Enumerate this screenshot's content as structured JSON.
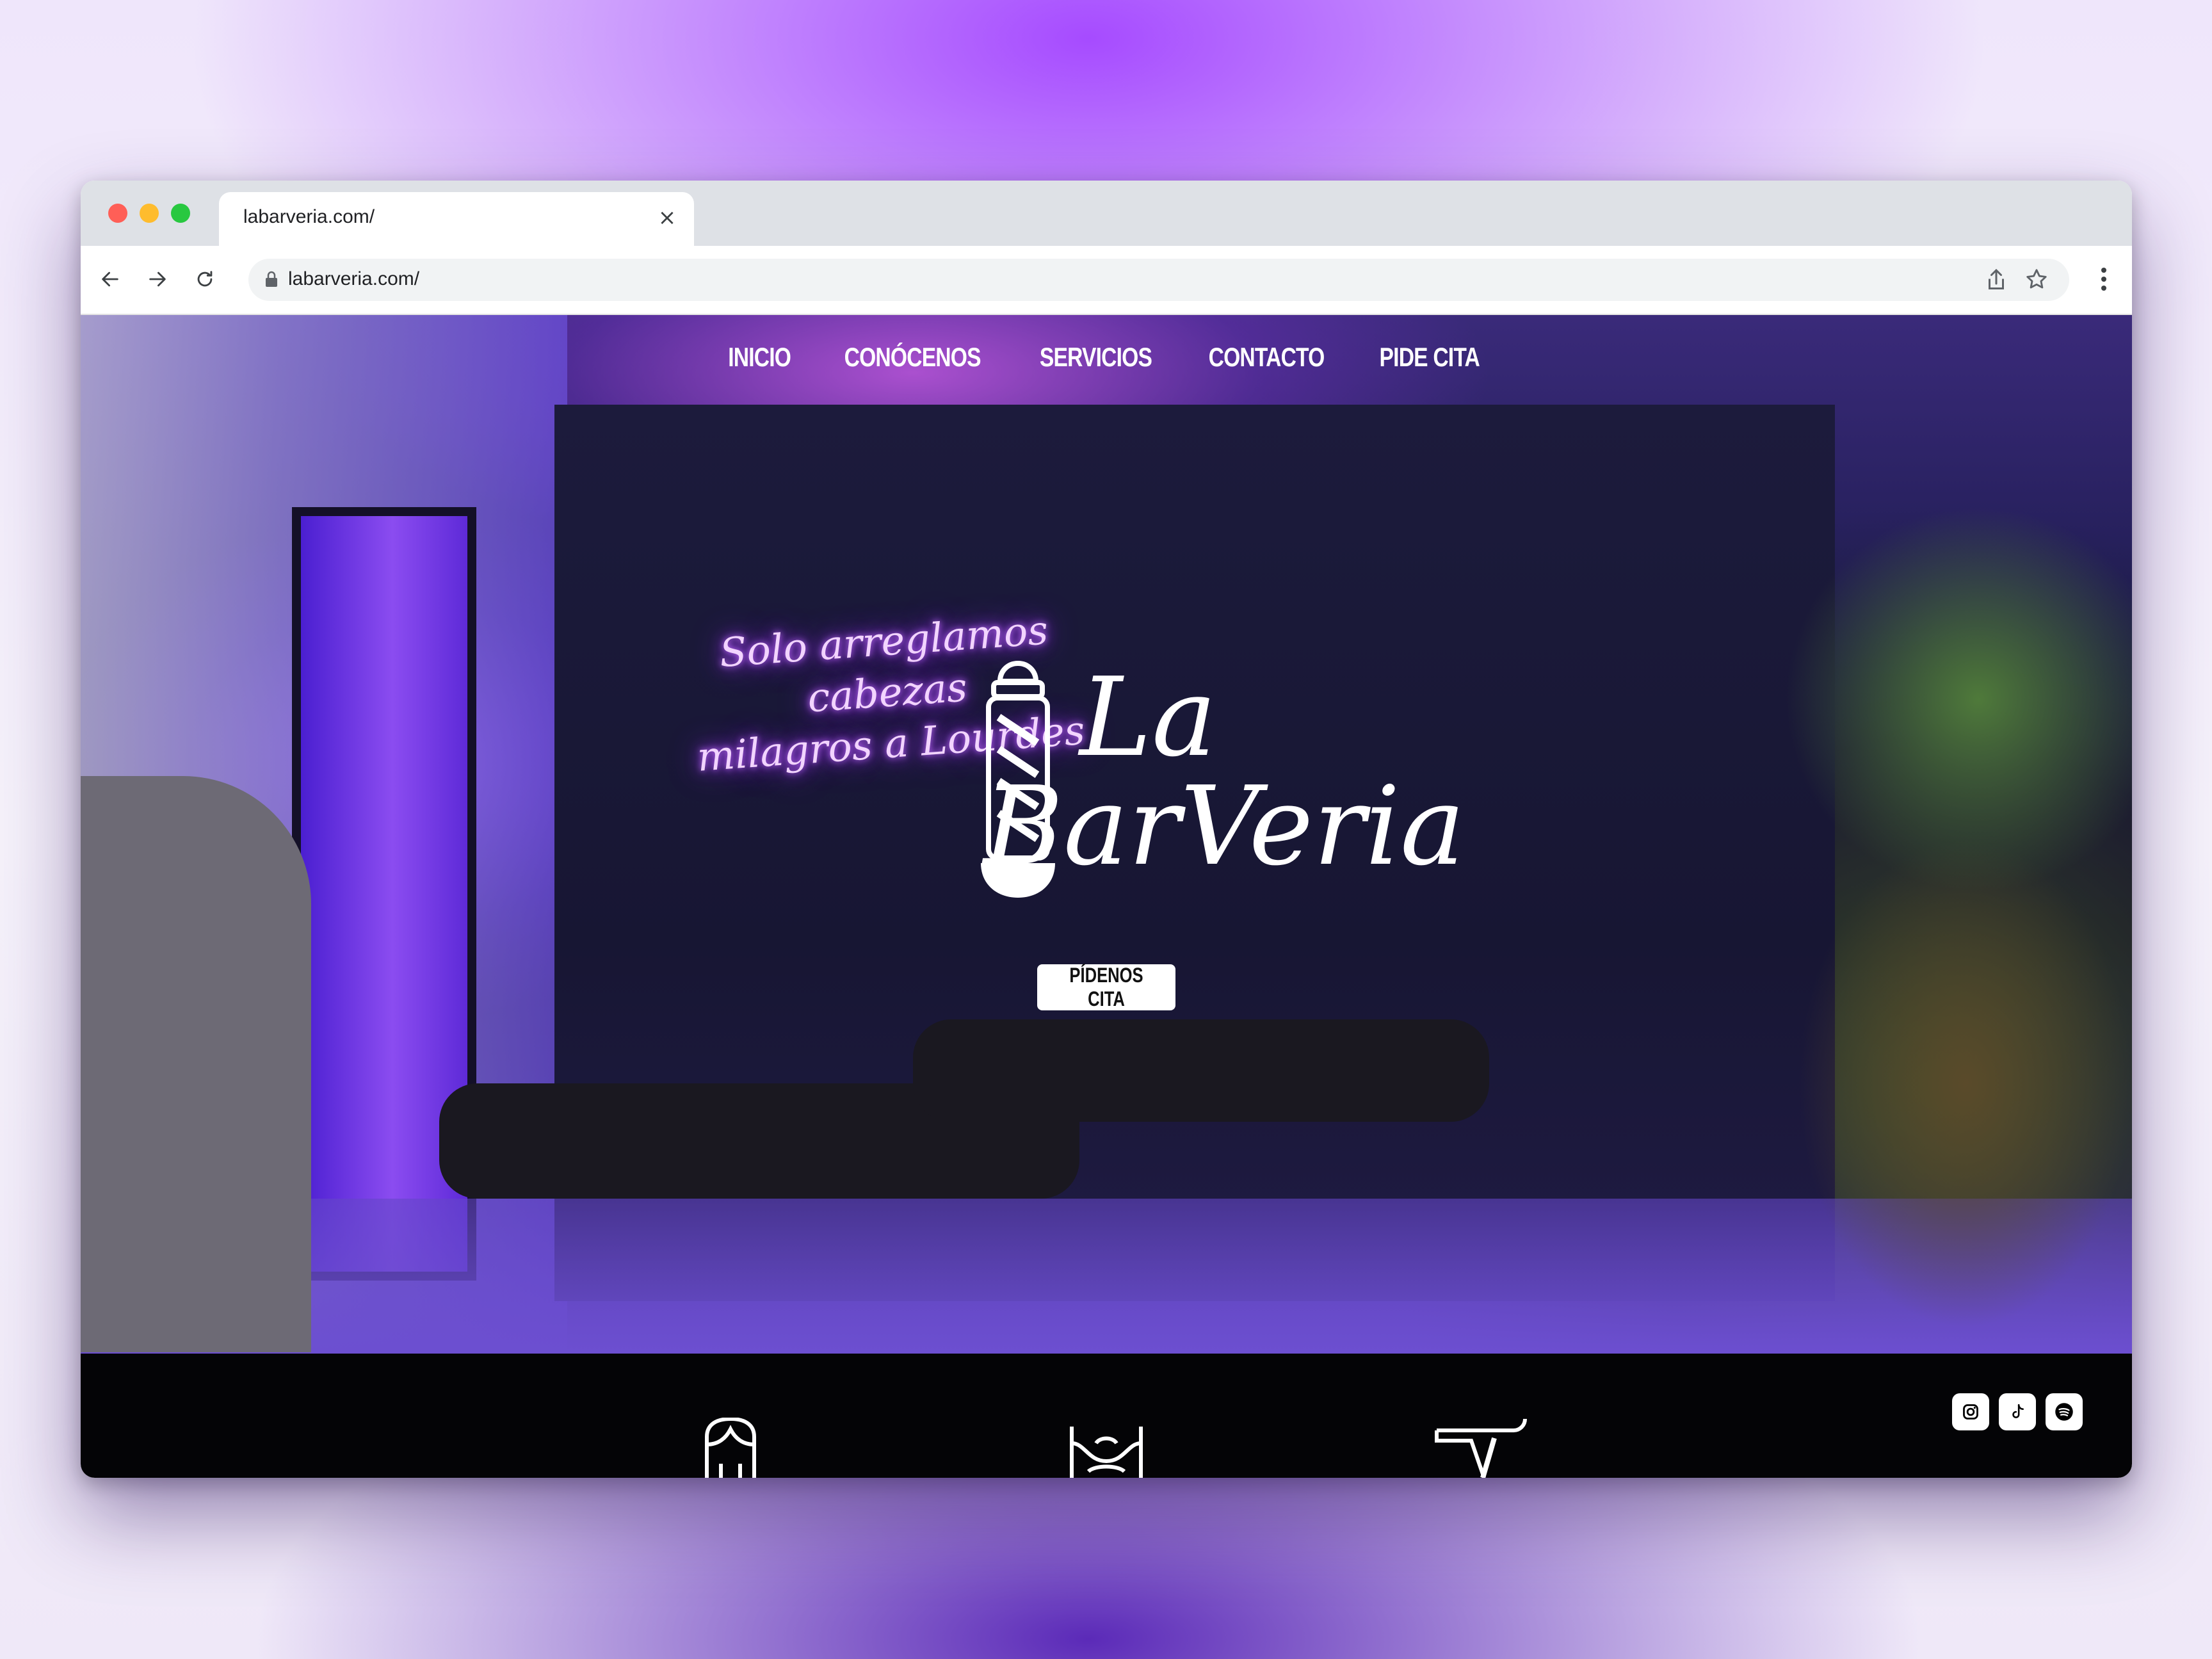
{
  "browser": {
    "tab_title": "labarveria.com/",
    "url": "labarveria.com/"
  },
  "nav": {
    "items": [
      "INICIO",
      "CONÓCENOS",
      "SERVICIOS",
      "CONTACTO",
      "PIDE CITA"
    ]
  },
  "hero": {
    "neon_line1": "Solo arreglamos cabezas",
    "neon_line2": "milagros a Lourdes",
    "logo_la": "La",
    "logo_barveria": "BarVeria",
    "cta_label": "PÍDENOS CITA"
  },
  "footer": {
    "social_icons": [
      "instagram-icon",
      "tiktok-icon",
      "spotify-icon"
    ],
    "service_icons": [
      "haircut-icon",
      "beard-icon",
      "razor-icon"
    ]
  },
  "colors": {
    "accent_purple": "#a64bff",
    "nav_text": "#ffffff",
    "footer_bg": "#040406"
  }
}
